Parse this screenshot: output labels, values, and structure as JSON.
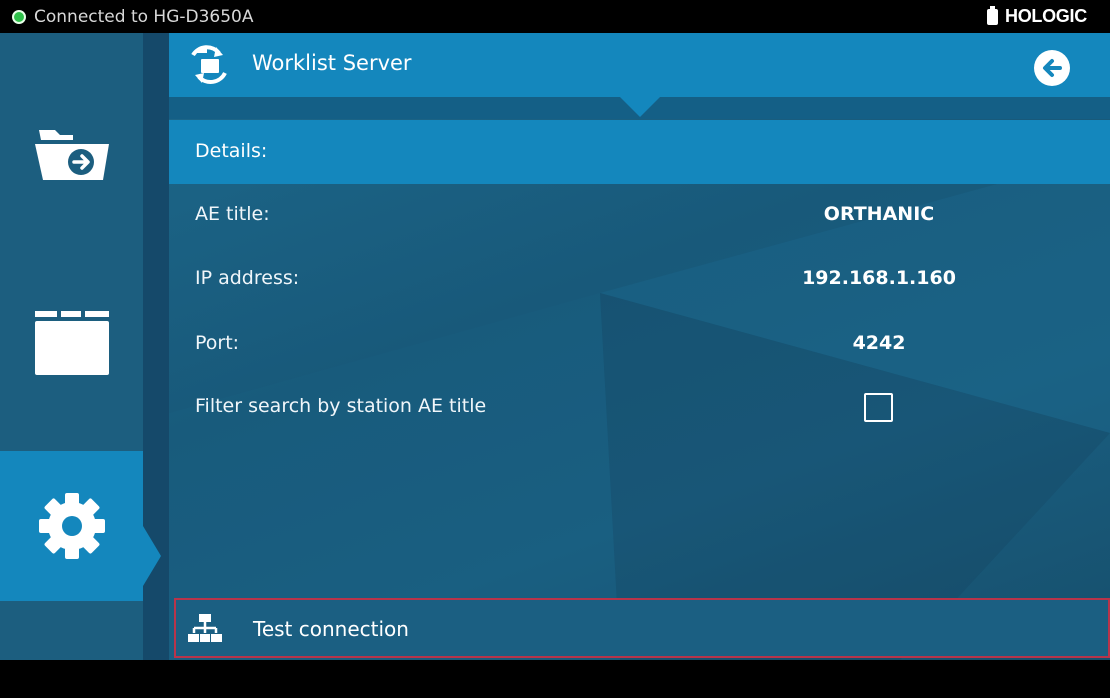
{
  "status": {
    "connection_text": "Connected to HG-D3650A",
    "connection_color": "#2ec24a",
    "brand": "HOLOGIC"
  },
  "sidebar": {
    "items": [
      {
        "icon": "folder-arrow-icon",
        "active": false
      },
      {
        "icon": "folder-icon",
        "active": false
      },
      {
        "icon": "gear-icon",
        "active": true
      }
    ]
  },
  "header": {
    "icon": "worklist-server-icon",
    "title": "Worklist Server",
    "back_icon": "arrow-left-circle-icon"
  },
  "details": {
    "heading": "Details:",
    "rows": [
      {
        "label": "AE title:",
        "value": "ORTHANIC"
      },
      {
        "label": "IP address:",
        "value": "192.168.1.160"
      },
      {
        "label": "Port:",
        "value": "4242"
      }
    ],
    "filter": {
      "label": "Filter search by station AE title",
      "checked": false
    }
  },
  "test_connection": {
    "label": "Test connection",
    "icon": "network-icon"
  },
  "colors": {
    "accent": "#1487bd",
    "panel": "#1c5e7f",
    "highlight_border": "#b8344a"
  }
}
